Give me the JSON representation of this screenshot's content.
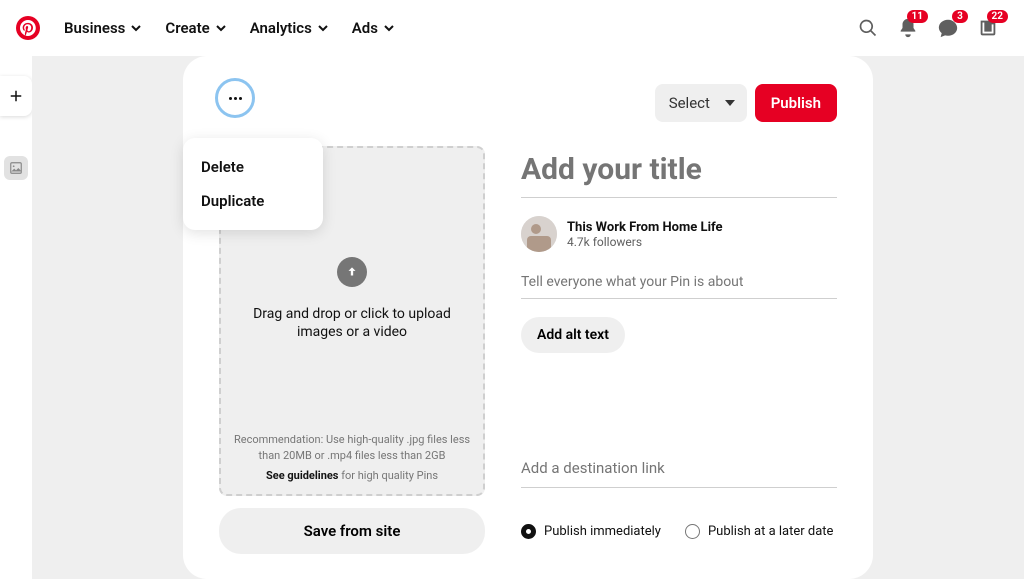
{
  "nav": {
    "items": [
      "Business",
      "Create",
      "Analytics",
      "Ads"
    ],
    "badges": {
      "bell": "11",
      "chat": "3",
      "news": "22"
    }
  },
  "card": {
    "menu": {
      "delete": "Delete",
      "duplicate": "Duplicate"
    },
    "select_label": "Select",
    "publish_label": "Publish"
  },
  "upload": {
    "main_text": "Drag and drop or click to upload images or a video",
    "hint": "Recommendation: Use high-quality .jpg files less than 20MB or .mp4 files less than 2GB",
    "see_label": "See guidelines",
    "see_suffix": " for high quality Pins",
    "save_from_site": "Save from site"
  },
  "form": {
    "title_placeholder": "Add your title",
    "author_name": "This Work From Home Life",
    "author_followers": "4.7k followers",
    "desc_placeholder": "Tell everyone what your Pin is about",
    "alt_btn": "Add alt text",
    "dest_placeholder": "Add a destination link",
    "radio_now": "Publish immediately",
    "radio_later": "Publish at a later date"
  }
}
